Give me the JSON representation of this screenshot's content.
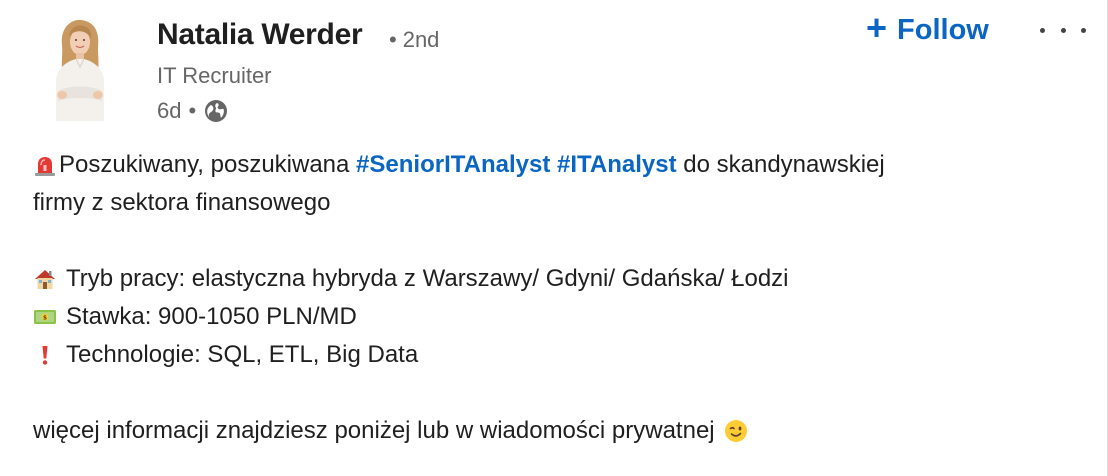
{
  "post": {
    "author": {
      "name": "Natalia Werder",
      "degree_separator": "•",
      "degree": "2nd",
      "headline": "IT Recruiter",
      "time": "6d",
      "meta_separator": "•",
      "visibility_icon": "globe-icon"
    },
    "actions": {
      "follow_plus": "+",
      "follow_label": "Follow",
      "more_icon": "more-icon"
    },
    "body": {
      "line1_emoji": "siren-icon",
      "line1_prefix": "Poszukiwany, poszukiwana ",
      "hashtag1": "#SeniorITAnalyst",
      "line1_between": " ",
      "hashtag2": "#ITAnalyst",
      "line1_suffix": " do skandynawskiej",
      "line2": "firmy z sektora finansowego",
      "line3_emoji": "house-icon",
      "line3": "Tryb pracy: elastyczna hybryda z Warszawy/ Gdyni/ Gdańska/ Łodzi",
      "line4_emoji": "money-icon",
      "line4": "Stawka: 900-1050 PLN/MD",
      "line5_emoji": "exclamation-icon",
      "line5": "Technologie: SQL, ETL, Big Data",
      "line6": "więcej informacji znajdziesz poniżej lub w wiadomości prywatnej",
      "line6_emoji": "wink-emoji-icon"
    },
    "colors": {
      "link": "#0a66c2",
      "muted": "#666666",
      "text": "#1f1f1f"
    }
  }
}
